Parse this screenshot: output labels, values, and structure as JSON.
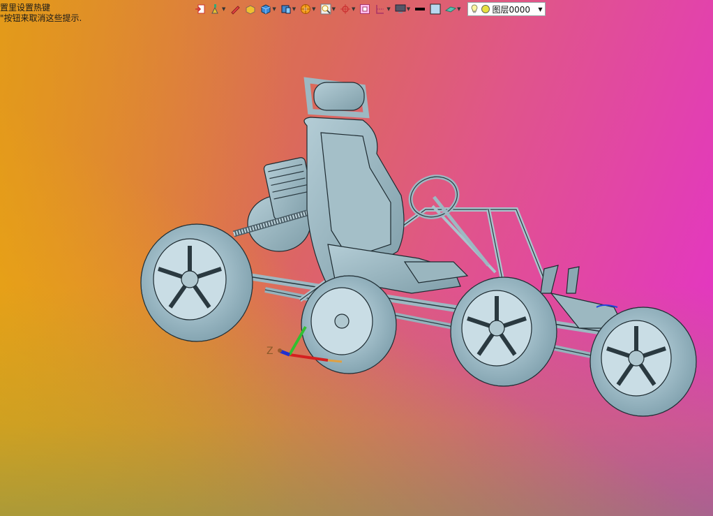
{
  "hint": {
    "line1": "置里设置热键",
    "line2": "\"按钮来取消这些提示."
  },
  "toolbar": {
    "icons": [
      "layer-move-icon",
      "paint-icon",
      "pencil-icon",
      "box-paint-icon",
      "cube-view-icon",
      "cube-display-icon",
      "wheel-filter-icon",
      "zoom-fit-icon",
      "orient-icon",
      "frame-icon",
      "section-icon",
      "monitor-icon",
      "line-width-icon",
      "color-swatch-icon",
      "plane-icon"
    ],
    "layer_label": "图层0000",
    "colors": {
      "layer_bg": "#ffffff",
      "swatch": "#b8d8f0"
    }
  },
  "axes": {
    "z_label": "Z"
  }
}
